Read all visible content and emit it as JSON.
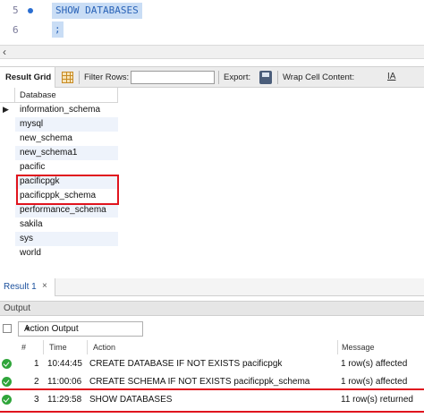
{
  "editor": {
    "lines": [
      {
        "number": "5",
        "code": "SHOW DATABASES"
      },
      {
        "number": "6",
        "code": ";"
      }
    ]
  },
  "toolbar": {
    "result_grid_label": "Result Grid",
    "filter_rows_label": "Filter Rows:",
    "filter_rows_value": "",
    "export_label": "Export:",
    "wrap_cell_label": "Wrap Cell Content:",
    "wrap_icon": "IA"
  },
  "grid": {
    "column": "Database",
    "rows": [
      "information_schema",
      "mysql",
      "new_schema",
      "new_schema1",
      "pacific",
      "pacificpgk",
      "pacificppk_schema",
      "performance_schema",
      "sakila",
      "sys",
      "world"
    ]
  },
  "result_tabs": [
    {
      "label": "Result 1",
      "close": "×"
    }
  ],
  "output": {
    "header": "Output",
    "selector": "Action Output",
    "columns": {
      "num": "#",
      "time": "Time",
      "action": "Action",
      "message": "Message"
    },
    "rows": [
      {
        "num": "1",
        "time": "10:44:45",
        "action": "CREATE DATABASE IF NOT EXISTS pacificpgk",
        "message": "1 row(s) affected"
      },
      {
        "num": "2",
        "time": "11:00:06",
        "action": "CREATE SCHEMA IF NOT EXISTS pacificppk_schema",
        "message": "1 row(s) affected"
      },
      {
        "num": "3",
        "time": "11:29:58",
        "action": "SHOW DATABASES",
        "message": "11 row(s) returned"
      }
    ]
  },
  "colors": {
    "highlight_red": "#e0141e",
    "selection_blue": "#c9ddf5",
    "ok_green": "#2fa53a"
  }
}
